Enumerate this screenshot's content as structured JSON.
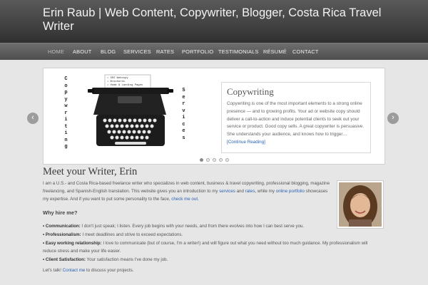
{
  "header": {
    "title": "Erin Raub | Web Content, Copywriter, Blogger, Costa Rica Travel Writer"
  },
  "nav": [
    "HOME",
    "ABOUT",
    "BLOG",
    "SERVICES",
    "RATES",
    "PORTFOLIO",
    "TESTIMONIALS",
    "RÉSUMÉ",
    "CONTACT"
  ],
  "slider": {
    "image": {
      "left_text": "Copywriting",
      "right_text": "Services",
      "paper_lines": [
        "• SEO Webcopy",
        "• Brochures",
        "• Home & Landing Pages"
      ]
    },
    "panel": {
      "title": "Copywriting",
      "text": "Copywriting is one of the most important elements to a strong online presence — and to growing profits. Your ad or website copy should deliver a call-to-action and induce potential clients to seek out your service or product. Good copy sells. A great copywriter is persuasive. She understands your audience, and knows how to trigger…",
      "link": "[Continue Reading]"
    },
    "prev_icon": "‹",
    "next_icon": "›",
    "slide_count": 5,
    "active_slide": 1
  },
  "main": {
    "title": "Meet your Writer, Erin",
    "intro": {
      "p1": "I am a U.S.- and Costa Rica-based freelance writer who specializes in web content, business & travel copywriting, professional blogging, magazine freelancing, and Spanish-English translation. This website gives you an introduction to my ",
      "link_services": "services",
      "and": " and ",
      "link_rates": "rates",
      "p2": ", while my ",
      "link_portfolio": "online portfolio",
      "p3": " showcases my expertise. And if you want to put some personality to the face, ",
      "link_checkout": "check me out",
      "end": "."
    },
    "why_title": "Why hire me?",
    "bullets": [
      {
        "label": "• Communication:",
        "text": " I don't just speak; I listen. Every job begins with your needs, and from there evolves into how I can best serve you."
      },
      {
        "label": "• Professionalism:",
        "text": " I meet deadlines and strive to exceed expectations."
      },
      {
        "label": "• Easy working relationship:",
        "text": " I love to communicate (but of course, I'm a writer!) and will figure out what you need without too much guidance. My professionalism will reduce stress and make your life easier."
      },
      {
        "label": "• Client Satisfaction:",
        "text": " Your satisfaction means I've done my job."
      }
    ],
    "closing": {
      "pre": "Let's talk! ",
      "link": "Contact me",
      "post": " to discuss your projects."
    }
  }
}
